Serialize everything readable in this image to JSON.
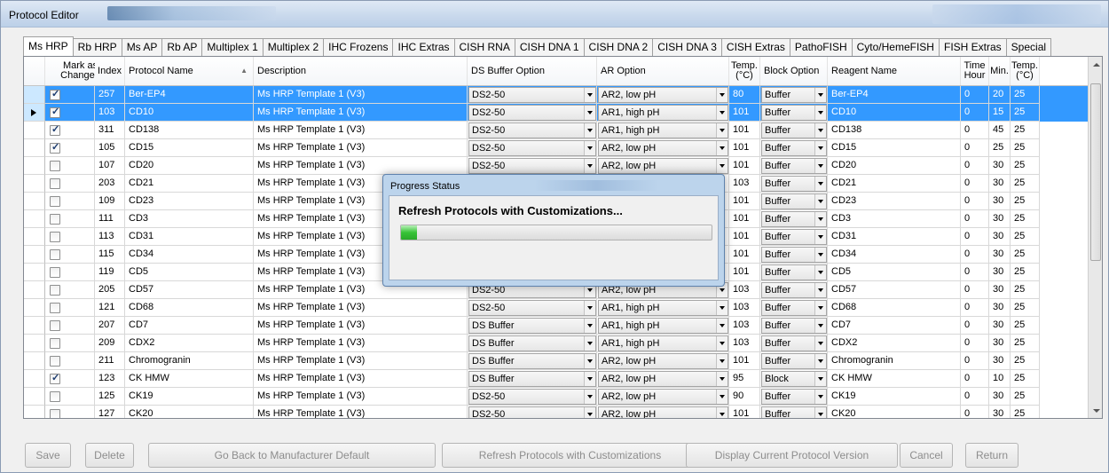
{
  "window": {
    "title": "Protocol Editor"
  },
  "tabs": [
    "Ms HRP",
    "Rb HRP",
    "Ms AP",
    "Rb AP",
    "Multiplex 1",
    "Multiplex 2",
    "IHC Frozens",
    "IHC Extras",
    "CISH RNA",
    "CISH DNA 1",
    "CISH DNA 2",
    "CISH DNA 3",
    "CISH Extras",
    "PathoFISH",
    "Cyto/HemeFISH",
    "FISH Extras",
    "Special"
  ],
  "active_tab": "Ms HRP",
  "columns": {
    "mark": "Mark as Changed",
    "index": "Index",
    "name": "Protocol Name",
    "desc": "Description",
    "ds": "DS Buffer Option",
    "ar": "AR Option",
    "temp": "Temp. (°C)",
    "block": "Block Option",
    "reagent": "Reagent Name",
    "hour": "Time Hour",
    "min": "Min.",
    "temp2": "Temp. (°C)"
  },
  "rows": [
    {
      "checked": true,
      "index": "257",
      "name": "Ber-EP4",
      "desc": "Ms HRP Template 1 (V3)",
      "ds": "DS2-50",
      "ar": "AR2, low pH",
      "temp": "80",
      "block": "Buffer",
      "reagent": "Ber-EP4",
      "hour": "0",
      "min": "20",
      "temp2": "25"
    },
    {
      "checked": true,
      "index": "103",
      "name": "CD10",
      "desc": "Ms HRP Template 1 (V3)",
      "ds": "DS2-50",
      "ar": "AR1, high pH",
      "temp": "101",
      "block": "Buffer",
      "reagent": "CD10",
      "hour": "0",
      "min": "15",
      "temp2": "25"
    },
    {
      "checked": true,
      "index": "311",
      "name": "CD138",
      "desc": "Ms HRP Template 1 (V3)",
      "ds": "DS2-50",
      "ar": "AR1, high pH",
      "temp": "101",
      "block": "Buffer",
      "reagent": "CD138",
      "hour": "0",
      "min": "45",
      "temp2": "25"
    },
    {
      "checked": true,
      "index": "105",
      "name": "CD15",
      "desc": "Ms HRP Template 1 (V3)",
      "ds": "DS2-50",
      "ar": "AR2, low pH",
      "temp": "101",
      "block": "Buffer",
      "reagent": "CD15",
      "hour": "0",
      "min": "25",
      "temp2": "25"
    },
    {
      "checked": false,
      "index": "107",
      "name": "CD20",
      "desc": "Ms HRP Template 1 (V3)",
      "ds": "DS2-50",
      "ar": "AR2, low pH",
      "temp": "101",
      "block": "Buffer",
      "reagent": "CD20",
      "hour": "0",
      "min": "30",
      "temp2": "25"
    },
    {
      "checked": false,
      "index": "203",
      "name": "CD21",
      "desc": "Ms HRP Template 1 (V3)",
      "ds": "",
      "ar": "",
      "temp": "103",
      "block": "Buffer",
      "reagent": "CD21",
      "hour": "0",
      "min": "30",
      "temp2": "25"
    },
    {
      "checked": false,
      "index": "109",
      "name": "CD23",
      "desc": "Ms HRP Template 1 (V3)",
      "ds": "",
      "ar": "",
      "temp": "101",
      "block": "Buffer",
      "reagent": "CD23",
      "hour": "0",
      "min": "30",
      "temp2": "25"
    },
    {
      "checked": false,
      "index": "111",
      "name": "CD3",
      "desc": "Ms HRP Template 1 (V3)",
      "ds": "",
      "ar": "",
      "temp": "101",
      "block": "Buffer",
      "reagent": "CD3",
      "hour": "0",
      "min": "30",
      "temp2": "25"
    },
    {
      "checked": false,
      "index": "113",
      "name": "CD31",
      "desc": "Ms HRP Template 1 (V3)",
      "ds": "",
      "ar": "",
      "temp": "101",
      "block": "Buffer",
      "reagent": "CD31",
      "hour": "0",
      "min": "30",
      "temp2": "25"
    },
    {
      "checked": false,
      "index": "115",
      "name": "CD34",
      "desc": "Ms HRP Template 1 (V3)",
      "ds": "",
      "ar": "",
      "temp": "101",
      "block": "Buffer",
      "reagent": "CD34",
      "hour": "0",
      "min": "30",
      "temp2": "25"
    },
    {
      "checked": false,
      "index": "119",
      "name": "CD5",
      "desc": "Ms HRP Template 1 (V3)",
      "ds": "",
      "ar": "",
      "temp": "101",
      "block": "Buffer",
      "reagent": "CD5",
      "hour": "0",
      "min": "30",
      "temp2": "25"
    },
    {
      "checked": false,
      "index": "205",
      "name": "CD57",
      "desc": "Ms HRP Template 1 (V3)",
      "ds": "DS2-50",
      "ar": "AR2, low pH",
      "temp": "103",
      "block": "Buffer",
      "reagent": "CD57",
      "hour": "0",
      "min": "30",
      "temp2": "25"
    },
    {
      "checked": false,
      "index": "121",
      "name": "CD68",
      "desc": "Ms HRP Template 1 (V3)",
      "ds": "DS2-50",
      "ar": "AR1, high pH",
      "temp": "103",
      "block": "Buffer",
      "reagent": "CD68",
      "hour": "0",
      "min": "30",
      "temp2": "25"
    },
    {
      "checked": false,
      "index": "207",
      "name": "CD7",
      "desc": "Ms HRP Template 1 (V3)",
      "ds": "DS Buffer",
      "ar": "AR1, high pH",
      "temp": "103",
      "block": "Buffer",
      "reagent": "CD7",
      "hour": "0",
      "min": "30",
      "temp2": "25"
    },
    {
      "checked": false,
      "index": "209",
      "name": "CDX2",
      "desc": "Ms HRP Template 1 (V3)",
      "ds": "DS Buffer",
      "ar": "AR1, high pH",
      "temp": "103",
      "block": "Buffer",
      "reagent": "CDX2",
      "hour": "0",
      "min": "30",
      "temp2": "25"
    },
    {
      "checked": false,
      "index": "211",
      "name": "Chromogranin",
      "desc": "Ms HRP Template 1 (V3)",
      "ds": "DS Buffer",
      "ar": "AR2, low pH",
      "temp": "101",
      "block": "Buffer",
      "reagent": "Chromogranin",
      "hour": "0",
      "min": "30",
      "temp2": "25"
    },
    {
      "checked": true,
      "index": "123",
      "name": "CK HMW",
      "desc": "Ms HRP Template 1 (V3)",
      "ds": "DS Buffer",
      "ar": "AR2, low pH",
      "temp": "95",
      "block": "Block",
      "reagent": "CK HMW",
      "hour": "0",
      "min": "10",
      "temp2": "25"
    },
    {
      "checked": false,
      "index": "125",
      "name": "CK19",
      "desc": "Ms HRP Template 1 (V3)",
      "ds": "DS2-50",
      "ar": "AR2, low pH",
      "temp": "90",
      "block": "Buffer",
      "reagent": "CK19",
      "hour": "0",
      "min": "30",
      "temp2": "25"
    },
    {
      "checked": false,
      "index": "127",
      "name": "CK20",
      "desc": "Ms HRP Template 1 (V3)",
      "ds": "DS2-50",
      "ar": "AR2, low pH",
      "temp": "101",
      "block": "Buffer",
      "reagent": "CK20",
      "hour": "0",
      "min": "30",
      "temp2": "25"
    }
  ],
  "selected_rows": [
    0,
    1
  ],
  "current_row": 1,
  "dialog": {
    "title": "Progress Status",
    "message": "Refresh Protocols with Customizations...",
    "progress": 0.05
  },
  "buttons": {
    "save": "Save",
    "delete": "Delete",
    "go_back": "Go Back to Manufacturer Default",
    "refresh": "Refresh Protocols with Customizations",
    "display": "Display Current Protocol Version",
    "cancel": "Cancel",
    "return": "Return"
  },
  "colors": {
    "selection": "#3399ff",
    "progress": "#37c437"
  }
}
